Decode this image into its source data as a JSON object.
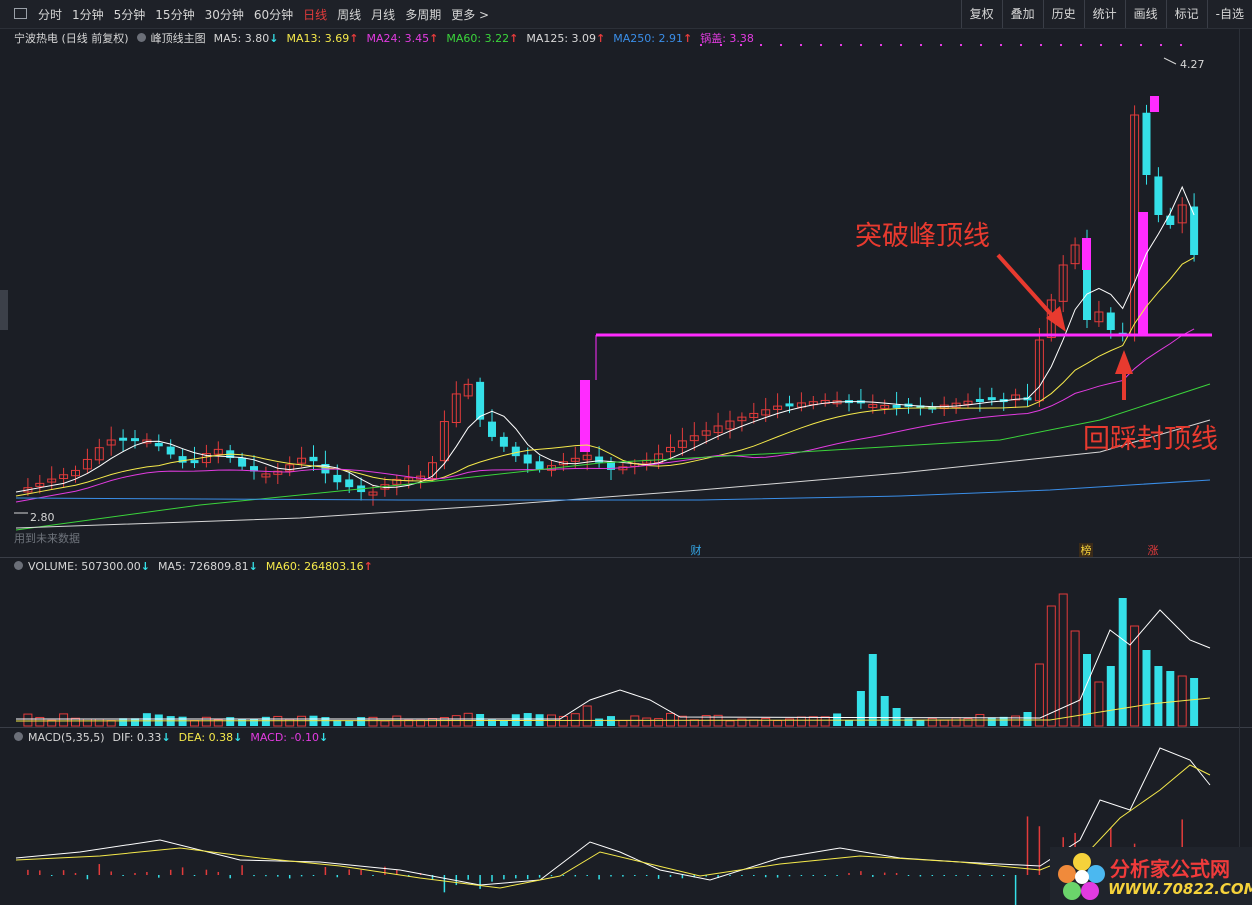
{
  "toolbar": {
    "tabs": [
      "分时",
      "1分钟",
      "5分钟",
      "15分钟",
      "30分钟",
      "60分钟",
      "日线",
      "周线",
      "月线",
      "多周期",
      "更多 >"
    ],
    "active_tab": "日线",
    "tools": [
      "复权",
      "叠加",
      "历史",
      "统计",
      "画线",
      "标记",
      "-自选"
    ]
  },
  "main_legend": {
    "stock": "宁波热电 (日线 前复权)",
    "indicator": "峰顶线主图",
    "ma5": "MA5: 3.80",
    "ma13": "MA13: 3.69",
    "ma24": "MA24: 3.45",
    "ma60": "MA60: 3.22",
    "ma125": "MA125: 3.09",
    "ma250": "MA250: 2.91",
    "guogai": "锅盖: 3.38",
    "up": "↑",
    "down": "↓"
  },
  "price_labels": {
    "high": "4.27",
    "low": "2.80",
    "hint": "用到未来数据"
  },
  "markers": {
    "cai": "财",
    "bang": "榜",
    "zhang": "涨"
  },
  "annotations": {
    "breakout": "突破峰顶线",
    "pullback": "回踩封顶线"
  },
  "volume_legend": {
    "volume": "VOLUME: 507300.00",
    "ma5": "MA5: 726809.81",
    "ma60": "MA60: 264803.16"
  },
  "macd_legend": {
    "name": "MACD(5,35,5)",
    "dif": "DIF: 0.33",
    "dea": "DEA: 0.38",
    "macd": "MACD: -0.10"
  },
  "watermark": {
    "title": "分析家公式网",
    "url": "WWW.70822.COM"
  },
  "colors": {
    "up": "#e23b3b",
    "down": "#35e0e8",
    "ma5": "#ffffff",
    "ma13": "#f5e94b",
    "ma24": "#e23be0",
    "ma60": "#3bd43b",
    "ma125": "#d8d8d8",
    "ma250": "#3a8ee8",
    "peak": "#ff2cff",
    "annotation": "#e83a2f"
  }
}
